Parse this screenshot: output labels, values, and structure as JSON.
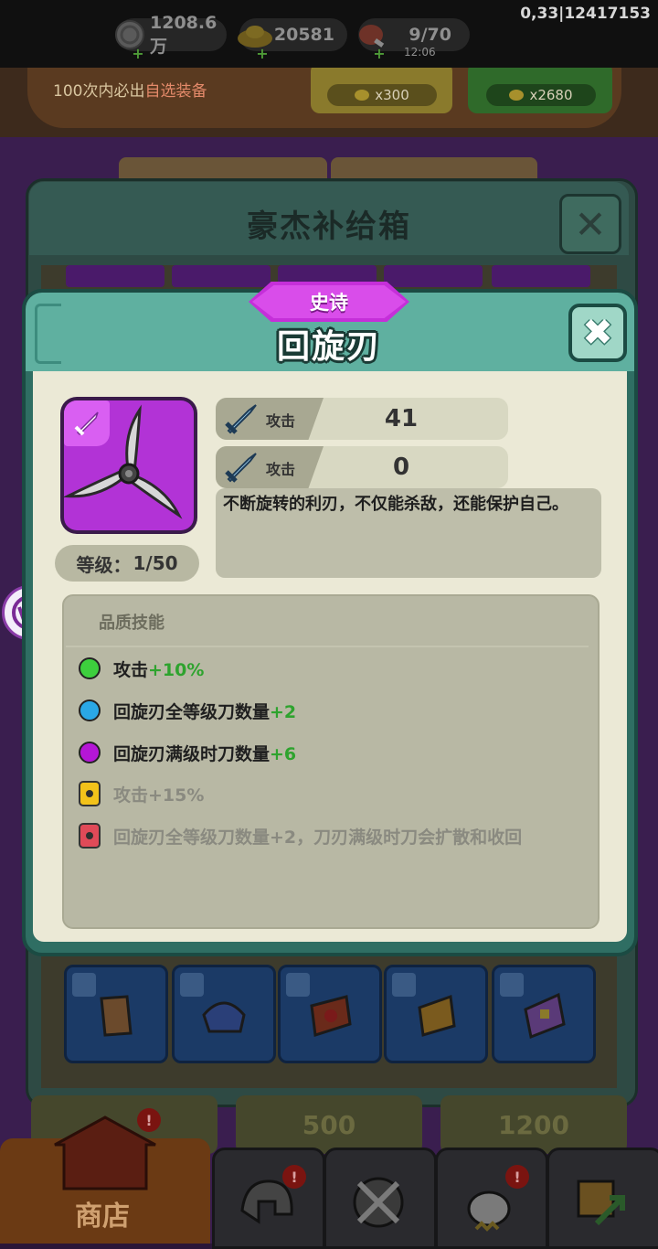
{
  "status_bar": {
    "silver": "1208.6万",
    "gold": "20581",
    "stamina": "9/70",
    "timer": "12:06",
    "corner_info": "0,33|12417153"
  },
  "background": {
    "banner_text_prefix": "100次内必出",
    "banner_text_highlight": "自选装备",
    "price_1": "x300",
    "price_2": "x2680",
    "supply_box_title": "豪杰补给箱",
    "buy_price_1": "500",
    "buy_price_2": "1200",
    "shop_label": "商店"
  },
  "dialog": {
    "rarity": "史诗",
    "title": "回旋刃",
    "level_label": "等级：",
    "level_value": "1/50",
    "stats": [
      {
        "label": "攻击",
        "value": "41"
      },
      {
        "label": "攻击",
        "value": "0"
      }
    ],
    "description": "不断旋转的利刃，不仅能杀敌，还能保护自己。",
    "skills_heading": "品质技能",
    "skills": [
      {
        "text": "攻击",
        "bonus": "+10%",
        "marker": "dot",
        "color": "#3dcf3d",
        "locked": false
      },
      {
        "text": "回旋刃全等级刀数量",
        "bonus": "+2",
        "marker": "dot",
        "color": "#2aa8e6",
        "locked": false
      },
      {
        "text": "回旋刃满级时刀数量",
        "bonus": "+6",
        "marker": "dot",
        "color": "#b516d6",
        "locked": false
      },
      {
        "text": "攻击+15%",
        "bonus": "",
        "marker": "lock",
        "color": "#f2c21a",
        "locked": true
      },
      {
        "text": "回旋刃全等级刀数量+2，刀刃满级时刀会扩散和收回",
        "bonus": "",
        "marker": "lock",
        "color": "#e04a58",
        "locked": true
      }
    ]
  },
  "colors": {
    "epic_purple": "#c52fd9",
    "dialog_teal": "#5fb0a0",
    "bonus_green": "#2ea32e"
  }
}
